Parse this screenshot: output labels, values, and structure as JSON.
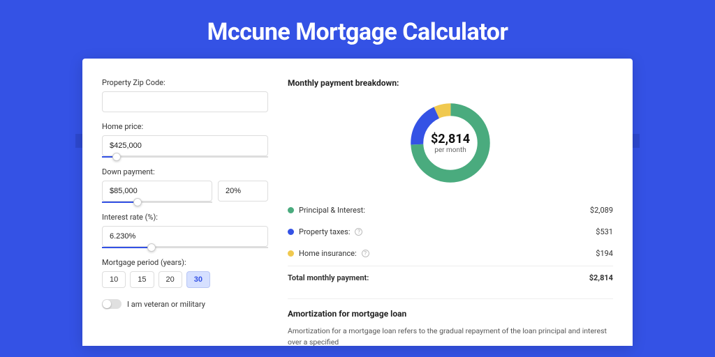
{
  "title": "Mccune Mortgage Calculator",
  "form": {
    "zip": {
      "label": "Property Zip Code:",
      "value": ""
    },
    "homePrice": {
      "label": "Home price:",
      "value": "$425,000",
      "slider_pct": 9
    },
    "downPayment": {
      "label": "Down payment:",
      "value": "$85,000",
      "pct": "20%",
      "slider_pct": 20
    },
    "interestRate": {
      "label": "Interest rate (%):",
      "value": "6.230%",
      "slider_pct": 30
    },
    "period": {
      "label": "Mortgage period (years):",
      "options": [
        "10",
        "15",
        "20",
        "30"
      ],
      "active": "30"
    },
    "veteran": {
      "label": "I am veteran or military",
      "on": false
    }
  },
  "breakdown": {
    "title": "Monthly payment breakdown:",
    "center_amount": "$2,814",
    "center_sub": "per month",
    "items": [
      {
        "label": "Principal & Interest:",
        "value": "$2,089",
        "color": "green",
        "info": false
      },
      {
        "label": "Property taxes:",
        "value": "$531",
        "color": "blue",
        "info": true
      },
      {
        "label": "Home insurance:",
        "value": "$194",
        "color": "yellow",
        "info": true
      }
    ],
    "total": {
      "label": "Total monthly payment:",
      "value": "$2,814"
    }
  },
  "amortization": {
    "title": "Amortization for mortgage loan",
    "text": "Amortization for a mortgage loan refers to the gradual repayment of the loan principal and interest over a specified"
  },
  "chart_data": {
    "type": "pie",
    "title": "Monthly payment breakdown",
    "series": [
      {
        "name": "Principal & Interest",
        "value": 2089,
        "color": "#4aab7e"
      },
      {
        "name": "Property taxes",
        "value": 531,
        "color": "#3452e5"
      },
      {
        "name": "Home insurance",
        "value": 194,
        "color": "#f0c94f"
      }
    ],
    "total": 2814,
    "center_label": "$2,814 per month"
  }
}
